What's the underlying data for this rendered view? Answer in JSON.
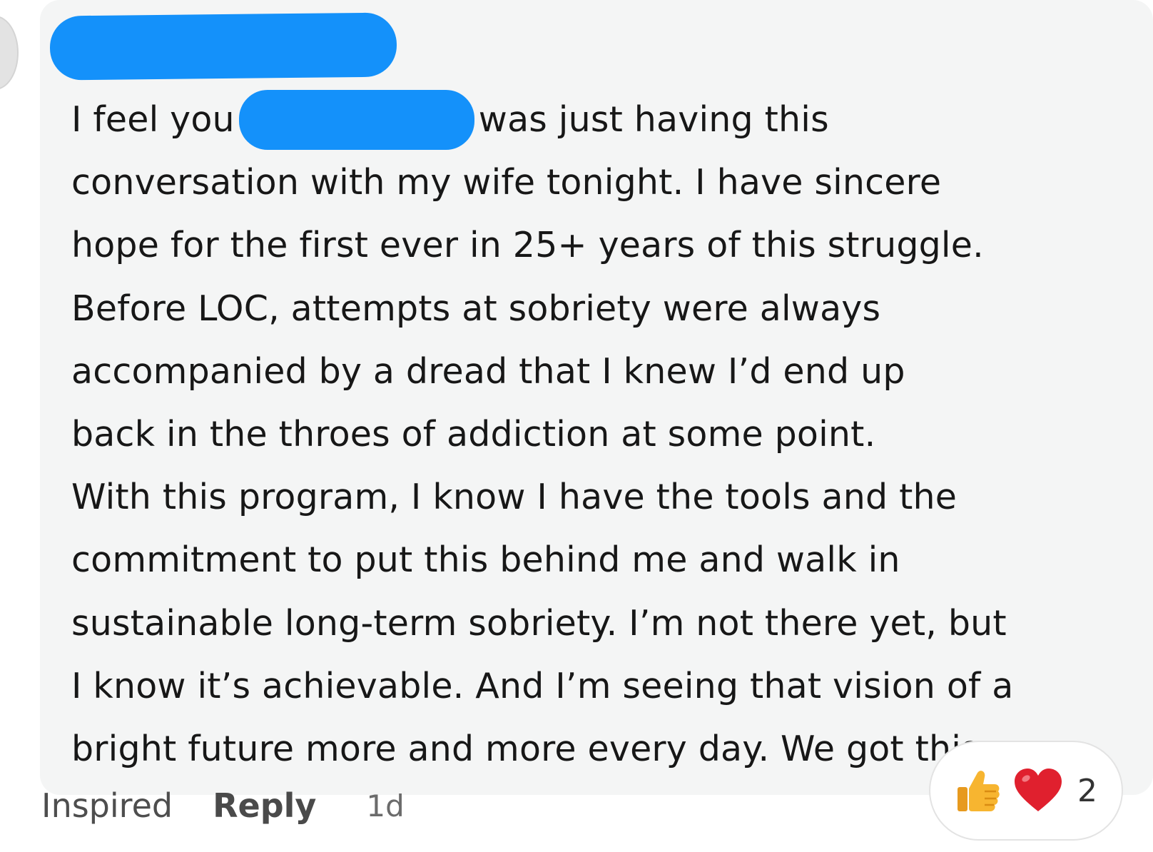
{
  "comment": {
    "lines": [
      {
        "before": "I feel you",
        "after": "was just having this"
      },
      "conversation with my wife tonight. I have sincere",
      "hope for the first ever in 25+ years of this struggle.",
      "Before LOC, attempts at sobriety were always",
      "accompanied by a dread that I knew I’d end up",
      "back in the throes of addiction at some point.",
      "With this program, I know I have the tools and the",
      "commitment to put this behind me and walk in",
      "sustainable long-term sobriety. I’m not there yet, but",
      "I know it’s achievable. And I’m seeing that vision of a",
      "bright future more and more every day. We got this."
    ]
  },
  "actions": {
    "inspired_label": "Inspired",
    "reply_label": "Reply",
    "timestamp": "1d"
  },
  "reactions": {
    "icons": [
      "thumbs-up-icon",
      "heart-icon"
    ],
    "count": "2"
  },
  "colors": {
    "bubble_background": "#f4f5f5",
    "redaction_blue": "#1491fa",
    "text": "#171717",
    "heart_red": "#e0202e",
    "thumb_yellow": "#f7b530"
  }
}
